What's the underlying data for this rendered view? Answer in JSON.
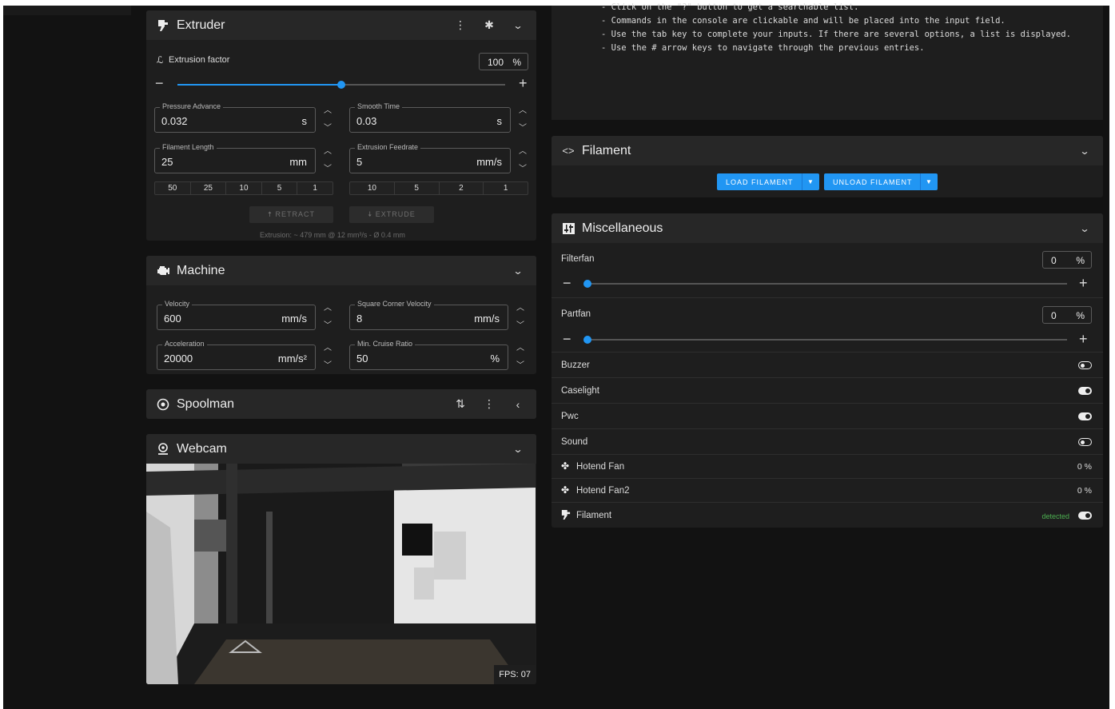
{
  "extruder": {
    "title": "Extruder",
    "extrusion_factor_label": "Extrusion factor",
    "extrusion_factor_value": "100",
    "extrusion_factor_unit": "%",
    "extrusion_factor_slider_fraction": 0.5,
    "pressure_advance": {
      "label": "Pressure Advance",
      "value": "0.032",
      "unit": "s"
    },
    "smooth_time": {
      "label": "Smooth Time",
      "value": "0.03",
      "unit": "s"
    },
    "filament_length": {
      "label": "Filament Length",
      "value": "25",
      "unit": "mm"
    },
    "extrusion_feedrate": {
      "label": "Extrusion Feedrate",
      "value": "5",
      "unit": "mm/s"
    },
    "length_presets": [
      "50",
      "25",
      "10",
      "5",
      "1"
    ],
    "feedrate_presets": [
      "10",
      "5",
      "2",
      "1"
    ],
    "retract_label": "RETRACT",
    "extrude_label": "EXTRUDE",
    "extrusion_note": "Extrusion: ~ 479 mm @ 12 mm³/s - Ø 0.4 mm"
  },
  "machine": {
    "title": "Machine",
    "velocity": {
      "label": "Velocity",
      "value": "600",
      "unit": "mm/s"
    },
    "square_corner_velocity": {
      "label": "Square Corner Velocity",
      "value": "8",
      "unit": "mm/s"
    },
    "acceleration": {
      "label": "Acceleration",
      "value": "20000",
      "unit": "mm/s²"
    },
    "min_cruise_ratio": {
      "label": "Min. Cruise Ratio",
      "value": "50",
      "unit": "%"
    }
  },
  "spoolman": {
    "title": "Spoolman"
  },
  "webcam": {
    "title": "Webcam",
    "fps": "FPS: 07"
  },
  "console": {
    "lines": [
      "- Click on the \"?\" button to get a searchable list.",
      "- Commands in the console are clickable and will be placed into the input field.",
      "- Use the tab key to complete your inputs. If there are several options, a list is displayed.",
      "- Use the # arrow keys to navigate through the previous entries."
    ]
  },
  "filament": {
    "title": "Filament",
    "load_label": "LOAD FILAMENT",
    "unload_label": "UNLOAD FILAMENT"
  },
  "misc": {
    "title": "Miscellaneous",
    "filterfan": {
      "label": "Filterfan",
      "value": "0",
      "unit": "%",
      "slider_fraction": 0.0
    },
    "partfan": {
      "label": "Partfan",
      "value": "0",
      "unit": "%",
      "slider_fraction": 0.0
    },
    "buzzer": {
      "label": "Buzzer",
      "state": "off"
    },
    "caselight": {
      "label": "Caselight",
      "state": "on"
    },
    "pwc": {
      "label": "Pwc",
      "state": "on"
    },
    "sound": {
      "label": "Sound",
      "state": "off"
    },
    "hotend_fan": {
      "label": "Hotend Fan",
      "value": "0 %"
    },
    "hotend_fan2": {
      "label": "Hotend Fan2",
      "value": "0 %"
    },
    "filament_sensor": {
      "label": "Filament",
      "status": "detected",
      "state": "on"
    }
  },
  "colors": {
    "accent": "#2196f3",
    "detected": "#4caf50"
  },
  "icons": [
    "extruder-icon",
    "kebab-menu-icon",
    "gear-icon",
    "chevron-down-icon",
    "engine-icon",
    "target-icon",
    "swap-vertical-icon",
    "chevron-left-icon",
    "webcam-icon",
    "code-icon",
    "equalizer-icon",
    "fan-icon",
    "filament-icon"
  ]
}
